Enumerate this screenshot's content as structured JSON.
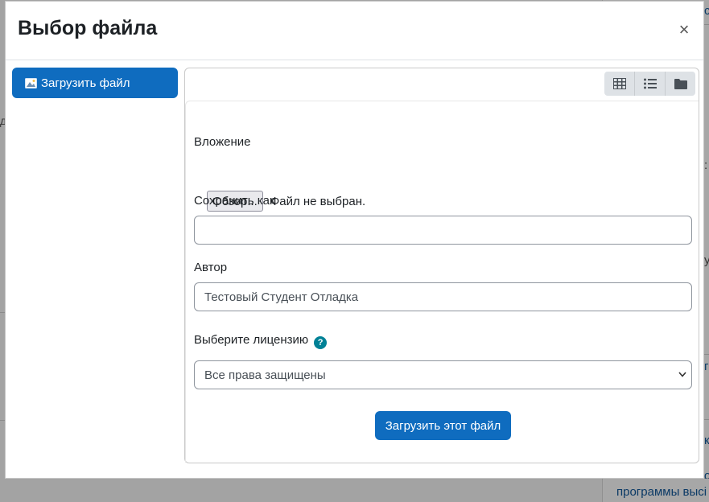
{
  "dialog": {
    "title": "Выбор файла",
    "close_glyph": "×"
  },
  "sidebar": {
    "items": [
      {
        "label": "Загрузить файл",
        "icon": "upload-icon",
        "active": true
      }
    ]
  },
  "toolbar": {
    "views": [
      {
        "name": "icons",
        "icon": "grid-icon"
      },
      {
        "name": "details",
        "icon": "list-icon"
      },
      {
        "name": "tree",
        "icon": "folder-icon"
      }
    ]
  },
  "form": {
    "attachment_label": "Вложение",
    "browse_label": "Обзор...",
    "file_status": "Файл не выбран.",
    "save_as_label": "Сохранить как",
    "save_as_value": "",
    "author_label": "Автор",
    "author_value": "Тестовый Студент Отладка",
    "license_label": "Выберите лицензию",
    "help_glyph": "?",
    "license_value": "Все права защищены",
    "submit_label": "Загрузить этот файл"
  },
  "background": {
    "partial_link": "программы высі"
  },
  "colors": {
    "primary": "#0f6cbf",
    "help": "#008196",
    "text": "#1d2125",
    "backdrop": "#a3a3a3"
  }
}
